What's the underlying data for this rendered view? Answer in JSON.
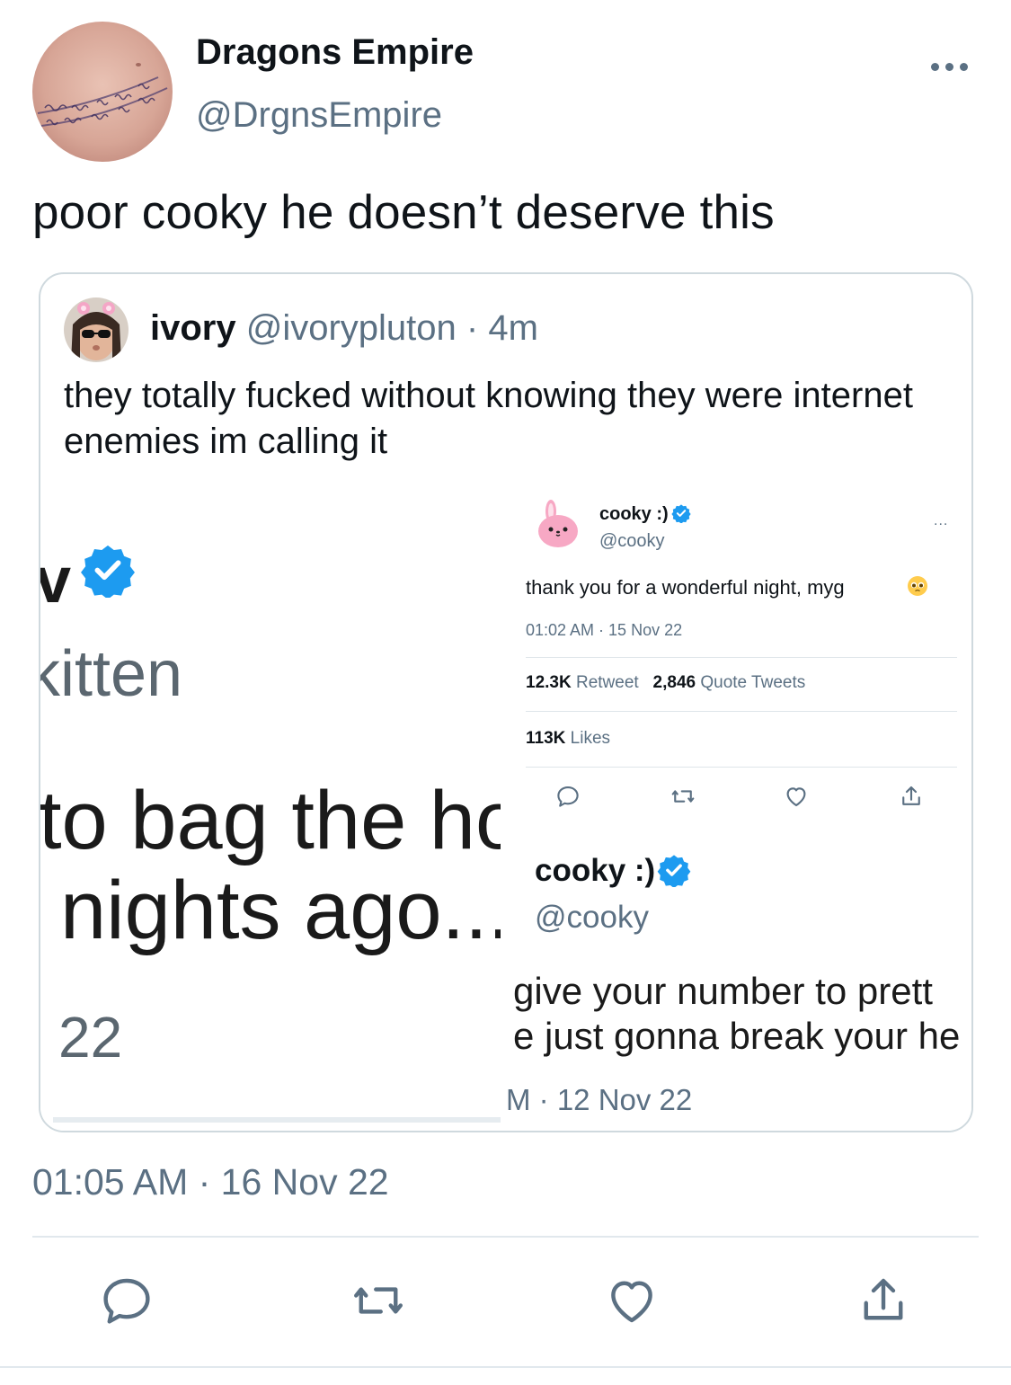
{
  "tweet": {
    "author_name": "Dragons Empire",
    "author_handle": "@DrgnsEmpire",
    "avatar_tattoo_text": "What doesn't kill me Will only make me stronger",
    "text": "poor cooky he doesn’t deserve this",
    "timestamp": "01:05 AM · 16 Nov 22"
  },
  "quote": {
    "author_name": "ivory",
    "author_handle": "@ivorypluton",
    "separator": "·",
    "time_ago": "4m",
    "text": "they totally fucked without knowing they were internet enemies im calling it",
    "left_screenshot": {
      "name_fragment": "v",
      "handle_fragment": "kitten",
      "line1": "to bag the ho",
      "line2": "nights ago...",
      "date_fragment": "22"
    },
    "right_screenshot": {
      "author_name": "cooky :)",
      "author_handle": "@cooky",
      "more": "...",
      "text": "thank you for a wonderful night, myg",
      "timestamp": "01:02 AM · 15 Nov 22",
      "retweets_count": "12.3K",
      "retweets_label": "Retweet",
      "quotes_count": "2,846",
      "quotes_label": "Quote Tweets",
      "likes_count": "113K",
      "likes_label": "Likes",
      "second_tweet": {
        "author_name": "cooky :)",
        "author_handle": "@cooky",
        "line1": "give your number to prett",
        "line2": "e just gonna break your he",
        "timestamp": "M · 12 Nov 22"
      }
    }
  },
  "colors": {
    "text_primary": "#0f1419",
    "text_secondary": "#5b7083",
    "border": "#cfd9de",
    "verified_blue": "#1d9bf0"
  },
  "icons": {
    "more": "more-horizontal-icon",
    "reply": "reply-icon",
    "retweet": "retweet-icon",
    "like": "heart-icon",
    "share": "share-icon",
    "verified": "verified-badge-icon"
  }
}
